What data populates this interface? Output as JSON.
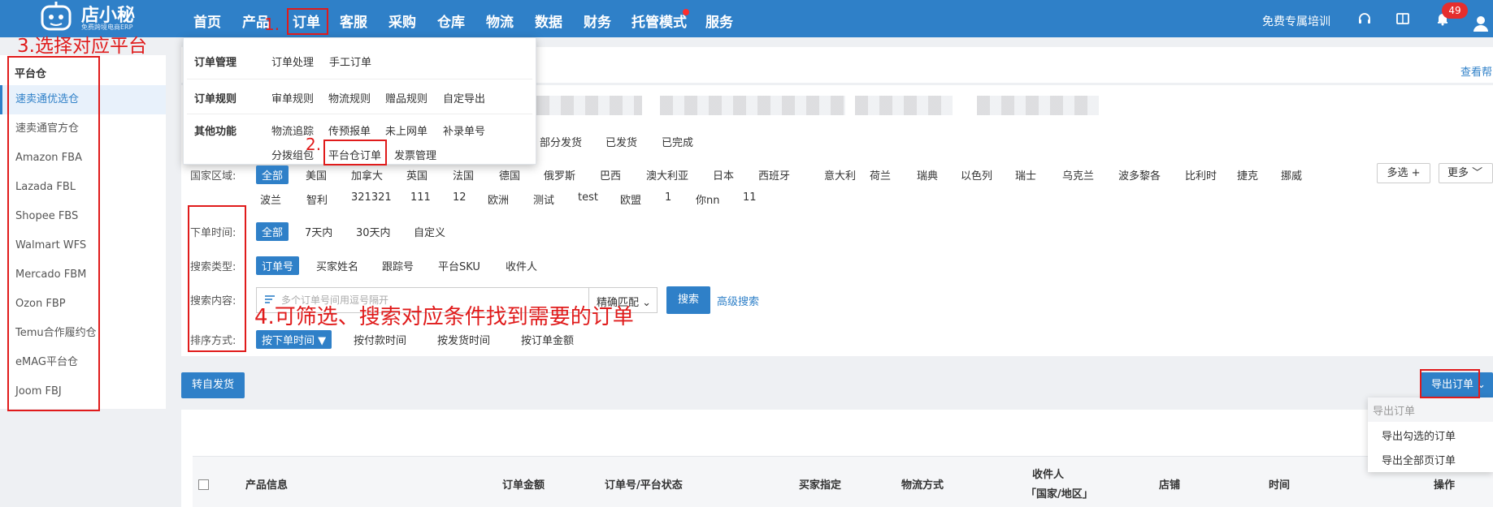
{
  "header": {
    "logo_text": "店小秘",
    "logo_subtitle": "免费跨境电商ERP",
    "nav": [
      "首页",
      "产品",
      "订单",
      "客服",
      "采购",
      "仓库",
      "物流",
      "数据",
      "财务",
      "托管模式",
      "服务"
    ],
    "training_link": "免费专属培训",
    "notification_count": "49"
  },
  "annotations": {
    "step1": "1.",
    "step2": "2.",
    "step3": "3.选择对应平台",
    "step4": "4.可筛选、搜索对应条件找到需要的订单"
  },
  "order_menu": {
    "groups": [
      {
        "title": "订单管理",
        "items": [
          "订单处理",
          "手工订单"
        ]
      },
      {
        "title": "订单规则",
        "items": [
          "审单规则",
          "物流规则",
          "赠品规则",
          "自定导出"
        ]
      },
      {
        "title": "其他功能",
        "items": [
          "物流追踪",
          "传预报单",
          "未上网单",
          "补录单号",
          "分拨组包",
          "平台仓订单",
          "发票管理"
        ]
      }
    ]
  },
  "sidebar": {
    "title": "平台仓",
    "items": [
      "速卖通优选仓",
      "速卖通官方仓",
      "Amazon FBA",
      "Lazada FBL",
      "Shopee FBS",
      "Walmart WFS",
      "Mercado FBM",
      "Ozon FBP",
      "Temu合作履约仓",
      "eMAG平台仓",
      "Joom FBJ"
    ]
  },
  "help_link": "查看帮",
  "status_tabs": [
    "部分发货",
    "已发货",
    "已完成"
  ],
  "filters": {
    "region": {
      "label": "国家区域:",
      "row1": [
        "全部",
        "美国",
        "加拿大",
        "英国",
        "法国",
        "德国",
        "俄罗斯",
        "巴西",
        "澳大利亚",
        "日本",
        "西班牙",
        "意大利",
        "荷兰",
        "瑞典",
        "以色列",
        "瑞士",
        "乌克兰",
        "波多黎各",
        "比利时",
        "捷克",
        "挪威"
      ],
      "row2": [
        "波兰",
        "智利",
        "321321",
        "111",
        "12",
        "欧洲",
        "测试",
        "test",
        "欧盟",
        "1",
        "你nn",
        "11"
      ],
      "multi_btn": "多选 +",
      "more_btn": "更多"
    },
    "order_time": {
      "label": "下单时间:",
      "options": [
        "全部",
        "7天内",
        "30天内",
        "自定义"
      ]
    },
    "search_type": {
      "label": "搜索类型:",
      "options": [
        "订单号",
        "买家姓名",
        "跟踪号",
        "平台SKU",
        "收件人"
      ]
    },
    "search_content": {
      "label": "搜索内容:",
      "placeholder": "多个订单号间用逗号隔开",
      "match": "精确匹配",
      "search_btn": "搜索",
      "advanced": "高级搜索"
    },
    "sort": {
      "label": "排序方式:",
      "options": [
        "按下单时间",
        "按付款时间",
        "按发货时间",
        "按订单金额"
      ]
    }
  },
  "actions": {
    "transfer_btn": "转自发货",
    "export_btn": "导出订单"
  },
  "export_menu": {
    "title": "导出订单",
    "items": [
      "导出勾选的订单",
      "导出全部页订单"
    ]
  },
  "table": {
    "headers": [
      "产品信息",
      "订单金额",
      "订单号/平台状态",
      "买家指定",
      "物流方式",
      "收件人",
      "「国家/地区」",
      "店铺",
      "时间",
      "操作"
    ]
  },
  "colors": {
    "primary": "#2f80c8",
    "annotation": "#e01b1b",
    "badge": "#e52e2e"
  }
}
